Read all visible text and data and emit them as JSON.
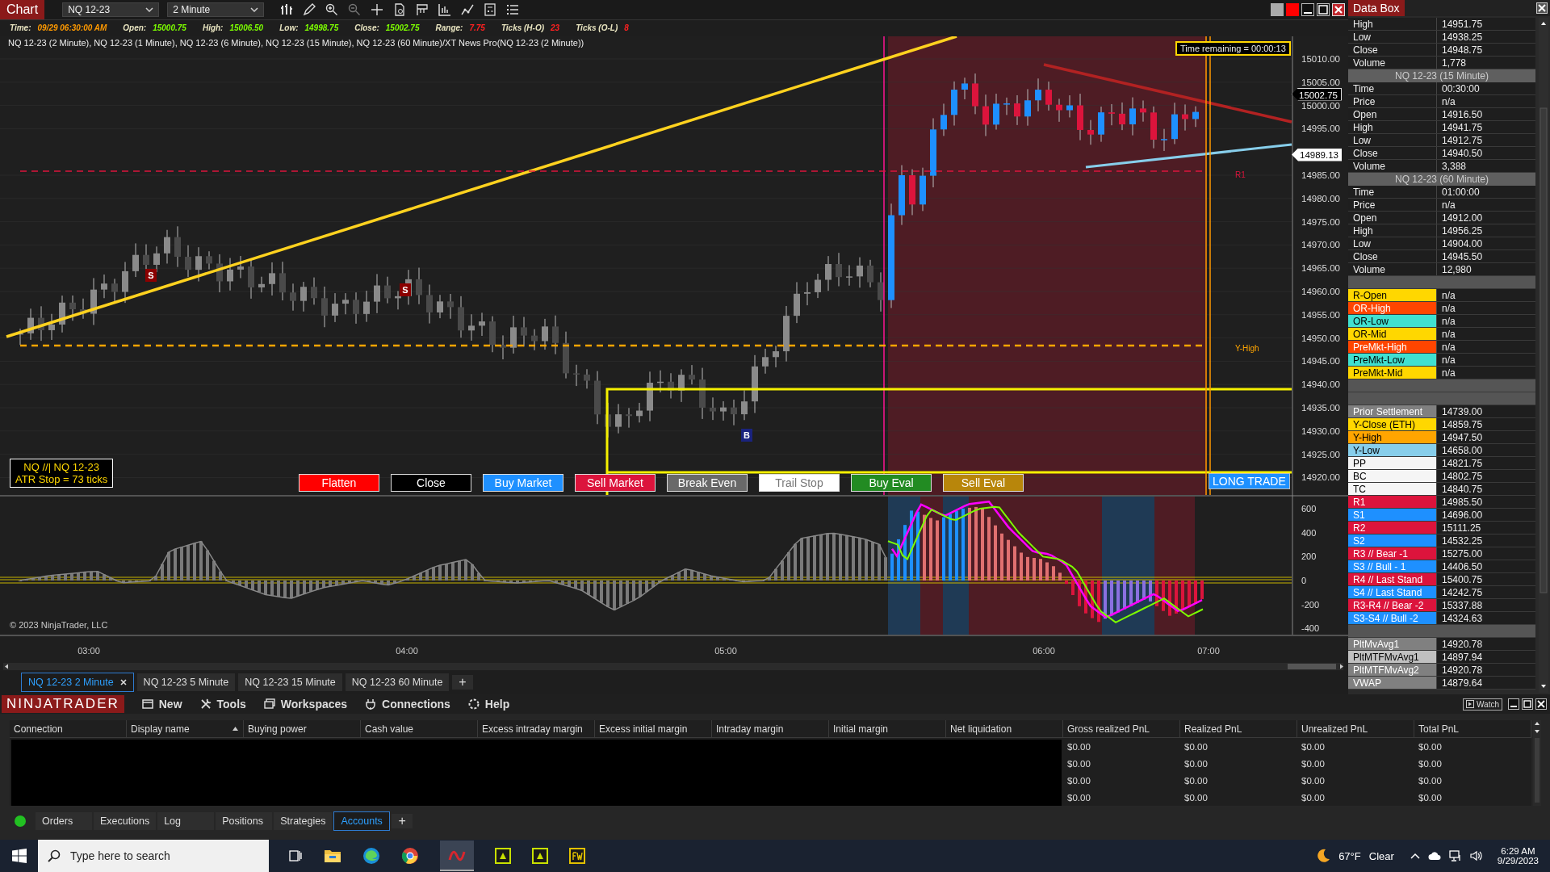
{
  "toolbar": {
    "title": "Chart",
    "instrument": "NQ 12-23",
    "interval": "2 Minute"
  },
  "info_bar": [
    {
      "label": "Time:",
      "value": "09/29 06:30:00 AM",
      "color": "#ff9a00"
    },
    {
      "label": "Open:",
      "value": "15000.75",
      "color": "#7cfc00"
    },
    {
      "label": "High:",
      "value": "15006.50",
      "color": "#7cfc00"
    },
    {
      "label": "Low:",
      "value": "14998.75",
      "color": "#7cfc00"
    },
    {
      "label": "Close:",
      "value": "15002.75",
      "color": "#7cfc00"
    },
    {
      "label": "Range:",
      "value": "7.75",
      "color": "#ff2020"
    },
    {
      "label": "Ticks (H-O)",
      "value": "23",
      "color": "#ff2020"
    },
    {
      "label": "Ticks (O-L)",
      "value": "8",
      "color": "#ff2020"
    }
  ],
  "indicators_line": "NQ 12-23 (2 Minute), NQ 12-23 (1 Minute), NQ 12-23 (6 Minute), NQ 12-23 (15 Minute), NQ 12-23 (60 Minute)/XT News Pro(NQ 12-23 (2 Minute))",
  "chart": {
    "price_labels": [
      "15010.00",
      "15005.00",
      "15000.00",
      "14995.00",
      "14985.00",
      "14980.00",
      "14975.00",
      "14970.00",
      "14965.00",
      "14960.00",
      "14955.00",
      "14950.00",
      "14945.00",
      "14940.00",
      "14935.00",
      "14930.00",
      "14925.00",
      "14920.00"
    ],
    "price_tags": [
      {
        "text": "15002.75",
        "kind": "dark"
      },
      {
        "text": "14989.13",
        "kind": "light"
      }
    ],
    "level_labels": [
      {
        "text": "R1",
        "color": "#dc143c"
      },
      {
        "text": "Y-High",
        "color": "#ffa500"
      }
    ],
    "markers": [
      {
        "text": "S",
        "kind": "sell"
      },
      {
        "text": "S",
        "kind": "sell"
      },
      {
        "text": "B",
        "kind": "buy"
      }
    ],
    "time_remaining": "Time remaining = 00:00:13",
    "atr_box": [
      "NQ //| NQ 12-23",
      "ATR Stop = 73 ticks"
    ],
    "trade_buttons": [
      {
        "label": "Flatten",
        "color": "#ff0000"
      },
      {
        "label": "Close",
        "color": "#000000"
      },
      {
        "label": "Buy Market",
        "color": "#1e90ff"
      },
      {
        "label": "Sell Market",
        "color": "#dc143c"
      },
      {
        "label": "Break Even",
        "color": "#696969"
      },
      {
        "label": "Trail Stop",
        "color": "#ffffff"
      },
      {
        "label": "Buy Eval",
        "color": "#228b22"
      },
      {
        "label": "Sell Eval",
        "color": "#b8860b"
      }
    ],
    "trade_status": "LONG TRADE",
    "oscillator_labels": [
      "600",
      "400",
      "200",
      "0",
      "-200",
      "-400"
    ],
    "copyright": "© 2023 NinjaTrader, LLC",
    "time_labels": [
      "03:00",
      "04:00",
      "05:00",
      "06:00",
      "07:00"
    ]
  },
  "chart_tabs": [
    {
      "label": "NQ 12-23 2 Minute",
      "selected": true
    },
    {
      "label": "NQ 12-23 5 Minute",
      "selected": false
    },
    {
      "label": "NQ 12-23 15 Minute",
      "selected": false
    },
    {
      "label": "NQ 12-23 60 Minute",
      "selected": false
    }
  ],
  "add_tab": "+",
  "data_box": {
    "title": "Data Box",
    "rows": [
      {
        "kind": "row",
        "label": "High",
        "value": "14951.75"
      },
      {
        "kind": "row",
        "label": "Low",
        "value": "14938.25"
      },
      {
        "kind": "row",
        "label": "Close",
        "value": "14948.75"
      },
      {
        "kind": "row",
        "label": "Volume",
        "value": "1,778"
      },
      {
        "kind": "header",
        "label": "NQ 12-23 (15 Minute)"
      },
      {
        "kind": "row",
        "label": "Time",
        "value": "00:30:00"
      },
      {
        "kind": "row",
        "label": "Price",
        "value": "n/a"
      },
      {
        "kind": "row",
        "label": "Open",
        "value": "14916.50"
      },
      {
        "kind": "row",
        "label": "High",
        "value": "14941.75"
      },
      {
        "kind": "row",
        "label": "Low",
        "value": "14912.75"
      },
      {
        "kind": "row",
        "label": "Close",
        "value": "14940.50"
      },
      {
        "kind": "row",
        "label": "Volume",
        "value": "3,388"
      },
      {
        "kind": "header",
        "label": "NQ 12-23 (60 Minute)"
      },
      {
        "kind": "row",
        "label": "Time",
        "value": "01:00:00"
      },
      {
        "kind": "row",
        "label": "Price",
        "value": "n/a"
      },
      {
        "kind": "row",
        "label": "Open",
        "value": "14912.00"
      },
      {
        "kind": "row",
        "label": "High",
        "value": "14956.25"
      },
      {
        "kind": "row",
        "label": "Low",
        "value": "14904.00"
      },
      {
        "kind": "row",
        "label": "Close",
        "value": "14945.50"
      },
      {
        "kind": "row",
        "label": "Volume",
        "value": "12,980"
      },
      {
        "kind": "blank"
      },
      {
        "kind": "swatch",
        "label": "R-Open",
        "value": "n/a",
        "color": "#ffd700"
      },
      {
        "kind": "swatch",
        "label": "OR-High",
        "value": "n/a",
        "color": "#ff4500"
      },
      {
        "kind": "swatch",
        "label": "OR-Low",
        "value": "n/a",
        "color": "#40e0d0"
      },
      {
        "kind": "swatch",
        "label": "OR-Mid",
        "value": "n/a",
        "color": "#ffd700"
      },
      {
        "kind": "swatch",
        "label": "PreMkt-High",
        "value": "n/a",
        "color": "#ff4500"
      },
      {
        "kind": "swatch",
        "label": "PreMkt-Low",
        "value": "n/a",
        "color": "#40e0d0"
      },
      {
        "kind": "swatch",
        "label": "PreMkt-Mid",
        "value": "n/a",
        "color": "#ffd700"
      },
      {
        "kind": "blank"
      },
      {
        "kind": "blank"
      },
      {
        "kind": "swatch",
        "label": "Prior Settlement",
        "value": "14739.00",
        "color": "#808080"
      },
      {
        "kind": "swatch",
        "label": "Y-Close (ETH)",
        "value": "14859.75",
        "color": "#ffd700"
      },
      {
        "kind": "swatch",
        "label": "Y-High",
        "value": "14947.50",
        "color": "#ffa500"
      },
      {
        "kind": "swatch",
        "label": "Y-Low",
        "value": "14658.00",
        "color": "#87ceeb"
      },
      {
        "kind": "swatch",
        "label": "PP",
        "value": "14821.75",
        "color": "#f5f5f5"
      },
      {
        "kind": "swatch",
        "label": "BC",
        "value": "14802.75",
        "color": "#f5f5f5"
      },
      {
        "kind": "swatch",
        "label": "TC",
        "value": "14840.75",
        "color": "#f5f5f5"
      },
      {
        "kind": "swatch",
        "label": "R1",
        "value": "14985.50",
        "color": "#dc143c"
      },
      {
        "kind": "swatch",
        "label": "S1",
        "value": "14696.00",
        "color": "#1e90ff"
      },
      {
        "kind": "swatch",
        "label": "R2",
        "value": "15111.25",
        "color": "#dc143c"
      },
      {
        "kind": "swatch",
        "label": "S2",
        "value": "14532.25",
        "color": "#1e90ff"
      },
      {
        "kind": "swatch",
        "label": "R3 // Bear -1",
        "value": "15275.00",
        "color": "#dc143c"
      },
      {
        "kind": "swatch",
        "label": "S3 // Bull - 1",
        "value": "14406.50",
        "color": "#1e90ff"
      },
      {
        "kind": "swatch",
        "label": "R4 // Last Stand",
        "value": "15400.75",
        "color": "#dc143c"
      },
      {
        "kind": "swatch",
        "label": "S4 // Last Stand",
        "value": "14242.75",
        "color": "#1e90ff"
      },
      {
        "kind": "swatch",
        "label": "R3-R4 // Bear -2",
        "value": "15337.88",
        "color": "#dc143c"
      },
      {
        "kind": "swatch",
        "label": "S3-S4 // Bull -2",
        "value": "14324.63",
        "color": "#1e90ff"
      },
      {
        "kind": "blank"
      },
      {
        "kind": "swatch",
        "label": "PltMvAvg1",
        "value": "14920.78",
        "color": "#808080"
      },
      {
        "kind": "swatch",
        "label": "PltMTFMvAvg1",
        "value": "14897.94",
        "color": "#c0c0c0"
      },
      {
        "kind": "swatch",
        "label": "PltMTFMvAvg2",
        "value": "14920.78",
        "color": "#808080"
      },
      {
        "kind": "swatch",
        "label": "VWAP",
        "value": "14879.64",
        "color": "#808080"
      }
    ]
  },
  "control_center": {
    "logo": "NINJATRADER",
    "menu": [
      {
        "label": "New",
        "kind": "new"
      },
      {
        "label": "Tools",
        "kind": "tools"
      },
      {
        "label": "Workspaces",
        "kind": "workspaces"
      },
      {
        "label": "Connections",
        "kind": "connections"
      },
      {
        "label": "Help",
        "kind": "help"
      }
    ],
    "watch": "Watch",
    "columns": [
      {
        "label": "Connection",
        "sorted": false
      },
      {
        "label": "Display name",
        "sorted": true
      },
      {
        "label": "Buying power",
        "sorted": false
      },
      {
        "label": "Cash value",
        "sorted": false
      },
      {
        "label": "Excess intraday margin",
        "sorted": false
      },
      {
        "label": "Excess initial margin",
        "sorted": false
      },
      {
        "label": "Intraday margin",
        "sorted": false
      },
      {
        "label": "Initial margin",
        "sorted": false
      },
      {
        "label": "Net liquidation",
        "sorted": false
      },
      {
        "label": "Gross realized PnL",
        "sorted": false
      },
      {
        "label": "Realized PnL",
        "sorted": false
      },
      {
        "label": "Unrealized PnL",
        "sorted": false
      },
      {
        "label": "Total PnL",
        "sorted": false
      }
    ],
    "rows": [
      [
        "$0.00",
        "$0.00",
        "$0.00",
        "$0.00"
      ],
      [
        "$0.00",
        "$0.00",
        "$0.00",
        "$0.00"
      ],
      [
        "$0.00",
        "$0.00",
        "$0.00",
        "$0.00"
      ],
      [
        "$0.00",
        "$0.00",
        "$0.00",
        "$0.00"
      ]
    ],
    "tabs": [
      {
        "label": "Orders",
        "selected": false
      },
      {
        "label": "Executions",
        "selected": false
      },
      {
        "label": "Log",
        "selected": false
      },
      {
        "label": "Positions",
        "selected": false
      },
      {
        "label": "Strategies",
        "selected": false
      },
      {
        "label": "Accounts",
        "selected": true
      }
    ],
    "add_tab": "+"
  },
  "taskbar": {
    "search_placeholder": "Type here to search",
    "temperature": "67°F",
    "condition": "Clear",
    "time": "6:29 AM",
    "date": "9/29/2023"
  }
}
